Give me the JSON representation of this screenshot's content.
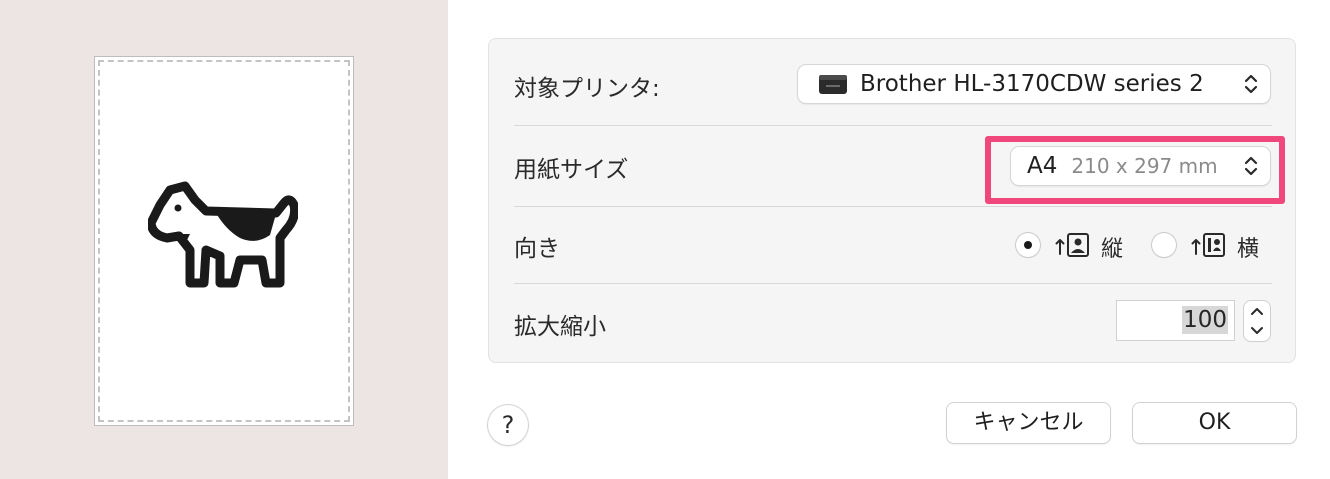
{
  "dialog": {
    "printer": {
      "label": "対象プリンタ:",
      "value": "Brother HL-3170CDW series 2",
      "icon": "printer-icon"
    },
    "paper_size": {
      "label": "用紙サイズ",
      "name": "A4",
      "dimensions": "210 x 297 mm"
    },
    "orientation": {
      "label": "向き",
      "options": [
        {
          "label": "縦",
          "icon": "portrait-icon",
          "selected": true
        },
        {
          "label": "横",
          "icon": "landscape-icon",
          "selected": false
        }
      ]
    },
    "scale": {
      "label": "拡大縮小",
      "value": "100"
    },
    "buttons": {
      "help": "?",
      "cancel": "キャンセル",
      "ok": "OK"
    }
  },
  "preview": {
    "image": "dogcow-icon"
  },
  "colors": {
    "highlight": "#f0477d",
    "preview_background": "#ede5e4",
    "panel_background": "#f5f5f5"
  }
}
